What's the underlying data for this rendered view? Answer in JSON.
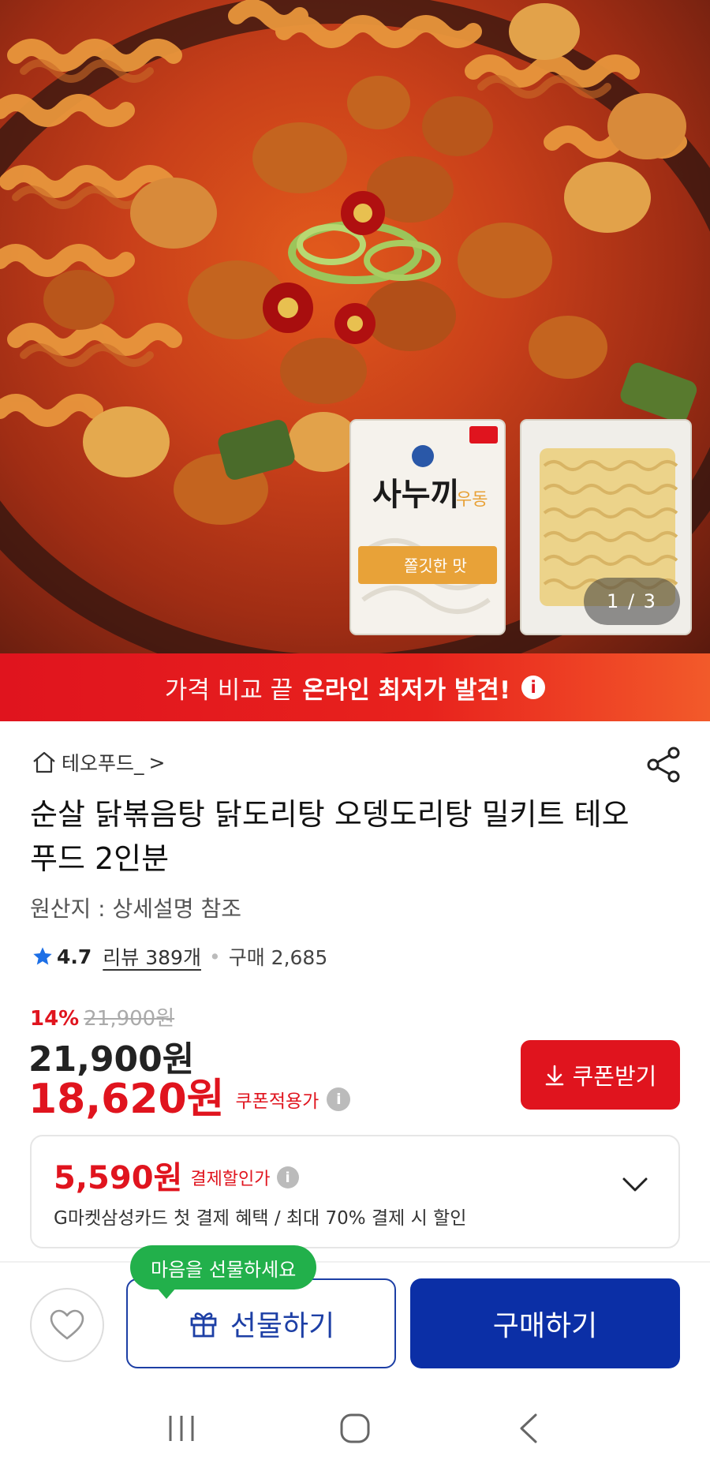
{
  "hero": {
    "package_brand_text": "사누끼우동",
    "package_tag_text": "쫄깃한 맛",
    "image_counter": "1 / 3"
  },
  "promo": {
    "light_text": "가격 비교 끝",
    "bold_text": "온라인 최저가 발견!",
    "icon": "info-icon"
  },
  "product": {
    "store_name": "테오푸드_",
    "store_chevron": ">",
    "title": "순살 닭볶음탕 닭도리탕 오뎅도리탕 밀키트 테오푸드 2인분",
    "origin": "원산지 : 상세설명 참조",
    "rating": "4.7",
    "review_text": "리뷰 389개",
    "purchase_text": "구매 2,685",
    "discount_pct": "14%",
    "original_price": "21,900원",
    "price": "21,900원",
    "coupon_price": "18,620원",
    "coupon_label": "쿠폰적용가",
    "coupon_button": "쿠폰받기"
  },
  "card_discount": {
    "amount": "5,590원",
    "label": "결제할인가",
    "description": "G마켓삼성카드 첫 결제 혜택 / 최대 70% 결제 시 할인"
  },
  "action_bar": {
    "tooltip": "마음을 선물하세요",
    "gift_button": "선물하기",
    "buy_button": "구매하기"
  },
  "colors": {
    "accent_red": "#e0141e",
    "primary_blue": "#0b2fa6",
    "tooltip_green": "#22b04b"
  }
}
